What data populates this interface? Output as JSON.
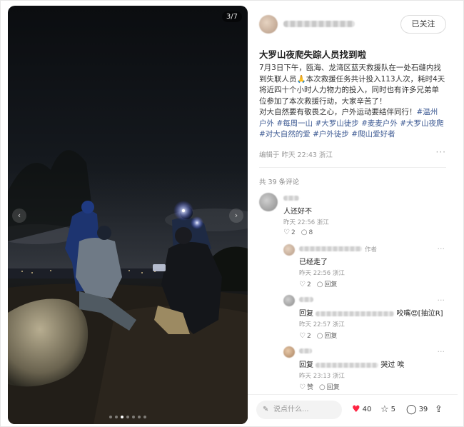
{
  "photo": {
    "counter": "3/7",
    "prev_icon": "chevron-left-icon",
    "next_icon": "chevron-right-icon",
    "dots_total": 7,
    "dots_active": 3
  },
  "author": {
    "follow_label": "已关注"
  },
  "post": {
    "title": "大罗山夜爬失踪人员找到啦",
    "lines": [
      "7月3日下午，瓯海、龙湾区蓝天救援队在一处石缝内找",
      "到失联人员🙏本次救援任务共计投入113人次，耗时4天",
      "将近四十个小时人力物力的投入，同时也有许多兄弟单",
      "位参加了本次救援行动，大家辛苦了！",
      "对大自然要有敬畏之心，户外运动要结伴同行！"
    ],
    "tags_line1": "#温州",
    "tags_line2": "户外 #每周一山 #大罗山徒步 #麦麦户外 #大罗山夜爬",
    "tags_line3": "#对大自然的爱 #户外徒步 #爬山爱好者",
    "meta": "编辑于 昨天 22:43 浙江"
  },
  "comments": {
    "count_label": "共 39 条评论",
    "items": [
      {
        "text": "人还好不",
        "meta": "昨天 22:56 浙江",
        "likes": "2",
        "replies": "8"
      },
      {
        "author_tag": "作者",
        "text": "已经走了",
        "meta": "昨天 22:56 浙江",
        "likes": "2",
        "reply_label": "回复"
      },
      {
        "text_prefix": "回复",
        "text_suffix": "咬嘴😍[抽泣R]",
        "meta": "昨天 22:57 浙江",
        "likes": "2",
        "reply_label": "回复"
      },
      {
        "text_prefix": "回复",
        "text_suffix": "哭过 唉",
        "meta": "昨天 23:13 浙江",
        "like_label": "赞",
        "reply_label": "回复"
      }
    ]
  },
  "bottom": {
    "placeholder": "说点什么...",
    "likes": "40",
    "stars": "5",
    "comments": "39"
  },
  "colors": {
    "accent": "#ff2442",
    "tag": "#3d5a93"
  }
}
